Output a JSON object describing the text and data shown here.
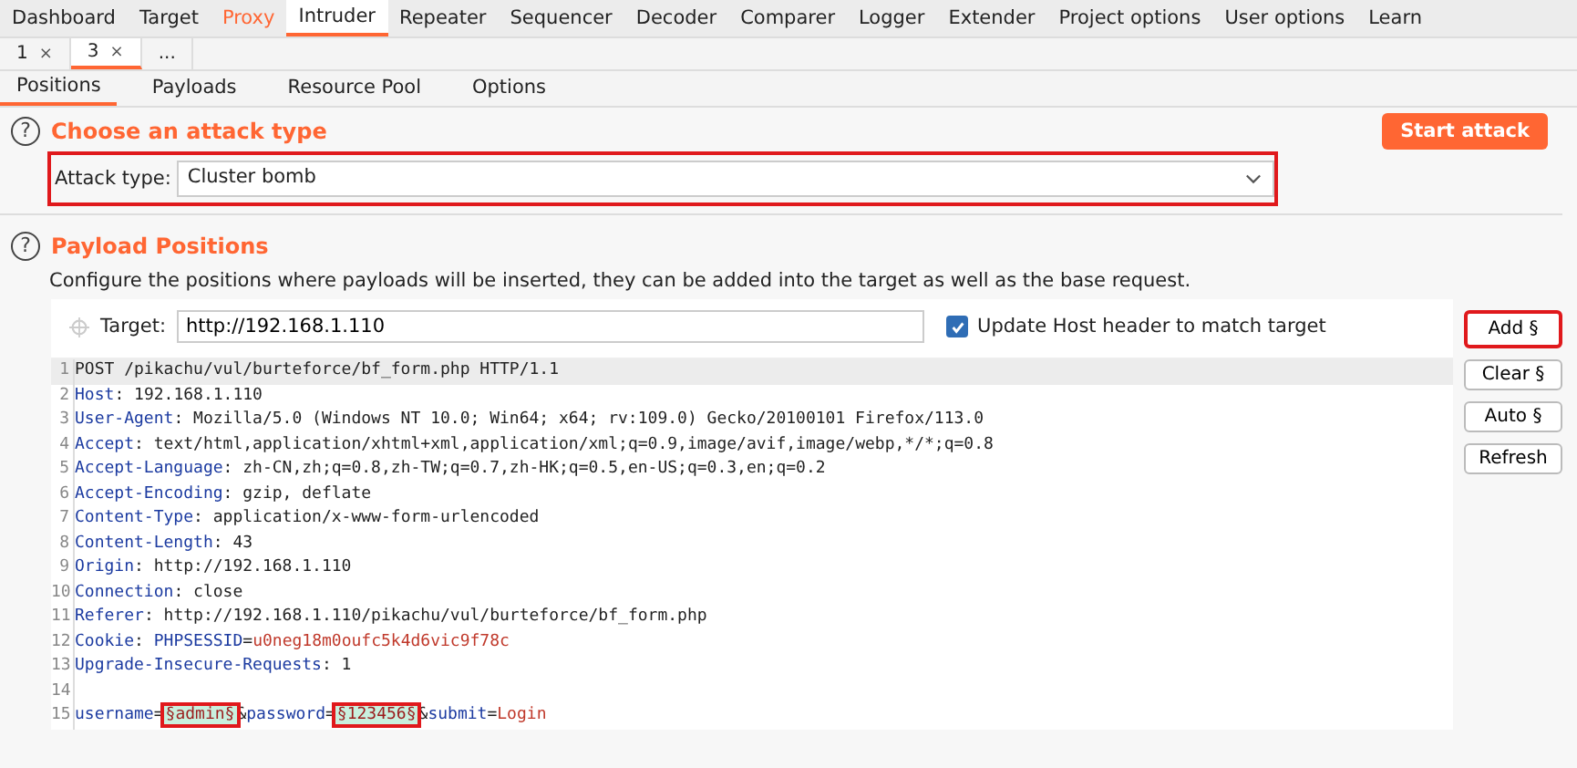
{
  "main_tabs": [
    {
      "label": "Dashboard",
      "selected": false,
      "alert": false
    },
    {
      "label": "Target",
      "selected": false,
      "alert": false
    },
    {
      "label": "Proxy",
      "selected": false,
      "alert": true
    },
    {
      "label": "Intruder",
      "selected": true,
      "alert": false
    },
    {
      "label": "Repeater",
      "selected": false,
      "alert": false
    },
    {
      "label": "Sequencer",
      "selected": false,
      "alert": false
    },
    {
      "label": "Decoder",
      "selected": false,
      "alert": false
    },
    {
      "label": "Comparer",
      "selected": false,
      "alert": false
    },
    {
      "label": "Logger",
      "selected": false,
      "alert": false
    },
    {
      "label": "Extender",
      "selected": false,
      "alert": false
    },
    {
      "label": "Project options",
      "selected": false,
      "alert": false
    },
    {
      "label": "User options",
      "selected": false,
      "alert": false
    },
    {
      "label": "Learn",
      "selected": false,
      "alert": false
    }
  ],
  "attack_tabs": [
    {
      "label": "1",
      "close": "×",
      "selected": false
    },
    {
      "label": "3",
      "close": "×",
      "selected": true
    },
    {
      "label": "...",
      "selected": false
    }
  ],
  "sub_tabs": [
    {
      "label": "Positions",
      "selected": true
    },
    {
      "label": "Payloads",
      "selected": false
    },
    {
      "label": "Resource Pool",
      "selected": false
    },
    {
      "label": "Options",
      "selected": false
    }
  ],
  "attack_type": {
    "help": "?",
    "title": "Choose an attack type",
    "start_button": "Start attack",
    "label": "Attack type:",
    "value": "Cluster bomb",
    "highlighted": true
  },
  "payload_positions": {
    "help": "?",
    "title": "Payload Positions",
    "description": "Configure the positions where payloads will be inserted, they can be added into the target as well as the base request.",
    "target_label": "Target:",
    "target_value": "http://192.168.1.110",
    "update_host": {
      "label": "Update Host header to match target",
      "checked": true
    },
    "buttons": [
      {
        "label": "Add §",
        "highlighted": true
      },
      {
        "label": "Clear §",
        "highlighted": false
      },
      {
        "label": "Auto §",
        "highlighted": false
      },
      {
        "label": "Refresh",
        "highlighted": false
      }
    ],
    "request_lines": [
      {
        "number": "1",
        "segments": [
          {
            "kind": "plain",
            "text": "POST /pikachu/vul/burteforce/bf_form.php HTTP/1.1"
          }
        ]
      },
      {
        "number": "2",
        "segments": [
          {
            "kind": "name",
            "text": "Host"
          },
          {
            "kind": "plain",
            "text": ": 192.168.1.110"
          }
        ]
      },
      {
        "number": "3",
        "segments": [
          {
            "kind": "name",
            "text": "User-Agent"
          },
          {
            "kind": "plain",
            "text": ": Mozilla/5.0 (Windows NT 10.0; Win64; x64; rv:109.0) Gecko/20100101 Firefox/113.0"
          }
        ]
      },
      {
        "number": "4",
        "segments": [
          {
            "kind": "name",
            "text": "Accept"
          },
          {
            "kind": "plain",
            "text": ": text/html,application/xhtml+xml,application/xml;q=0.9,image/avif,image/webp,*/*;q=0.8"
          }
        ]
      },
      {
        "number": "5",
        "segments": [
          {
            "kind": "name",
            "text": "Accept-Language"
          },
          {
            "kind": "plain",
            "text": ": zh-CN,zh;q=0.8,zh-TW;q=0.7,zh-HK;q=0.5,en-US;q=0.3,en;q=0.2"
          }
        ]
      },
      {
        "number": "6",
        "segments": [
          {
            "kind": "name",
            "text": "Accept-Encoding"
          },
          {
            "kind": "plain",
            "text": ": gzip, deflate"
          }
        ]
      },
      {
        "number": "7",
        "segments": [
          {
            "kind": "name",
            "text": "Content-Type"
          },
          {
            "kind": "plain",
            "text": ": application/x-www-form-urlencoded"
          }
        ]
      },
      {
        "number": "8",
        "segments": [
          {
            "kind": "name",
            "text": "Content-Length"
          },
          {
            "kind": "plain",
            "text": ": 43"
          }
        ]
      },
      {
        "number": "9",
        "segments": [
          {
            "kind": "name",
            "text": "Origin"
          },
          {
            "kind": "plain",
            "text": ": http://192.168.1.110"
          }
        ]
      },
      {
        "number": "10",
        "segments": [
          {
            "kind": "name",
            "text": "Connection"
          },
          {
            "kind": "plain",
            "text": ": close"
          }
        ]
      },
      {
        "number": "11",
        "segments": [
          {
            "kind": "name",
            "text": "Referer"
          },
          {
            "kind": "plain",
            "text": ": http://192.168.1.110/pikachu/vul/burteforce/bf_form.php"
          }
        ]
      },
      {
        "number": "12",
        "segments": [
          {
            "kind": "name",
            "text": "Cookie"
          },
          {
            "kind": "plain",
            "text": ": "
          },
          {
            "kind": "name",
            "text": "PHPSESSID"
          },
          {
            "kind": "plain",
            "text": "="
          },
          {
            "kind": "value",
            "text": "u0neg18m0oufc5k4d6vic9f78c"
          }
        ]
      },
      {
        "number": "13",
        "segments": [
          {
            "kind": "name",
            "text": "Upgrade-Insecure-Requests"
          },
          {
            "kind": "plain",
            "text": ": 1"
          }
        ]
      },
      {
        "number": "14"
      },
      {
        "number": "15",
        "segments": [
          {
            "kind": "name",
            "text": "username"
          },
          {
            "kind": "plain",
            "text": "="
          },
          {
            "kind": "marker",
            "text": "§admin§",
            "highlighted": true
          },
          {
            "kind": "plain",
            "text": "&"
          },
          {
            "kind": "name",
            "text": "password"
          },
          {
            "kind": "plain",
            "text": "="
          },
          {
            "kind": "marker",
            "text": "§123456§",
            "highlighted": true
          },
          {
            "kind": "plain",
            "text": "&"
          },
          {
            "kind": "name",
            "text": "submit"
          },
          {
            "kind": "plain",
            "text": "="
          },
          {
            "kind": "value",
            "text": "Login"
          }
        ]
      }
    ]
  }
}
